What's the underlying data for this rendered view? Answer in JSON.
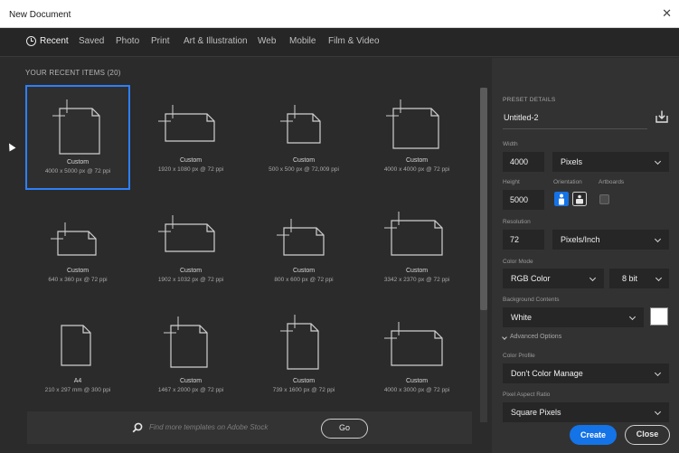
{
  "window": {
    "title": "New Document"
  },
  "tabs": [
    {
      "label": "Recent",
      "active": true
    },
    {
      "label": "Saved"
    },
    {
      "label": "Photo"
    },
    {
      "label": "Print"
    },
    {
      "label": "Art & Illustration"
    },
    {
      "label": "Web"
    },
    {
      "label": "Mobile"
    },
    {
      "label": "Film & Video"
    }
  ],
  "recent": {
    "header": "YOUR RECENT ITEMS (20)",
    "items": [
      {
        "name": "Custom",
        "size": "4000 x 5000 px @ 72 ppi",
        "selected": true,
        "shape": "portrait"
      },
      {
        "name": "Custom",
        "size": "1920 x 1080 px @ 72 ppi",
        "shape": "landscape"
      },
      {
        "name": "Custom",
        "size": "500 x 500 px @ 72,009 ppi",
        "shape": "square-small"
      },
      {
        "name": "Custom",
        "size": "4000 x 4000 px @ 72 ppi",
        "shape": "square"
      },
      {
        "name": "Custom",
        "size": "640 x 360 px @ 72 ppi",
        "shape": "wide-small"
      },
      {
        "name": "Custom",
        "size": "1902 x 1032 px @ 72 ppi",
        "shape": "landscape"
      },
      {
        "name": "Custom",
        "size": "800 x 600 px @ 72 ppi",
        "shape": "landscape-small"
      },
      {
        "name": "Custom",
        "size": "3342 x 2370 px @ 72 ppi",
        "shape": "landscape-large"
      },
      {
        "name": "A4",
        "size": "210 x 297 mm @ 300 ppi",
        "shape": "doc"
      },
      {
        "name": "Custom",
        "size": "1467 x 2000 px @ 72 ppi",
        "shape": "portrait-small"
      },
      {
        "name": "Custom",
        "size": "739 x 1600 px @ 72 ppi",
        "shape": "portrait-narrow"
      },
      {
        "name": "Custom",
        "size": "4000 x 3000 px @ 72 ppi",
        "shape": "landscape-large"
      }
    ]
  },
  "search": {
    "placeholder": "Find more templates on Adobe Stock",
    "go_label": "Go"
  },
  "preset": {
    "heading": "PRESET DETAILS",
    "doc_name": "Untitled-2",
    "width_label": "Width",
    "width_value": "4000",
    "width_unit": "Pixels",
    "height_label": "Height",
    "height_value": "5000",
    "orientation_label": "Orientation",
    "artboards_label": "Artboards",
    "resolution_label": "Resolution",
    "resolution_value": "72",
    "resolution_unit": "Pixels/Inch",
    "color_mode_label": "Color Mode",
    "color_mode_value": "RGB Color",
    "bit_depth_value": "8 bit",
    "bg_label": "Background Contents",
    "bg_value": "White",
    "advanced_label": "Advanced Options",
    "color_profile_label": "Color Profile",
    "color_profile_value": "Don't Color Manage",
    "pixel_aspect_label": "Pixel Aspect Ratio",
    "pixel_aspect_value": "Square Pixels"
  },
  "actions": {
    "create_label": "Create",
    "close_label": "Close"
  },
  "colors": {
    "accent": "#1473e6",
    "selection": "#2d7ff9",
    "background": "#2b2b2b",
    "panel": "#323232"
  }
}
